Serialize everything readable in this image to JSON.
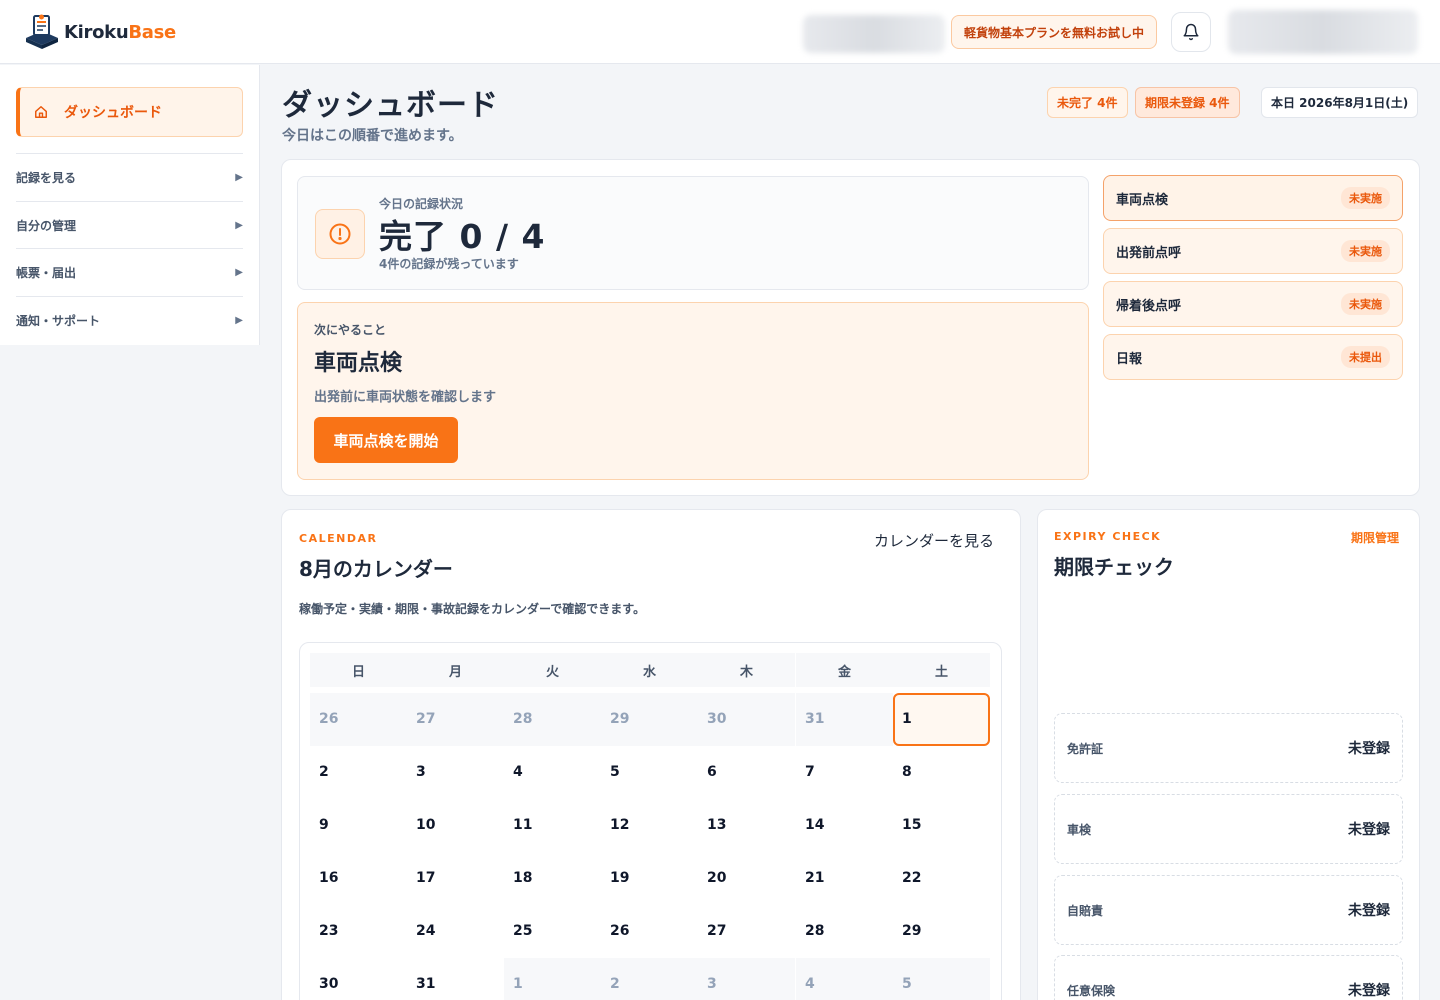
{
  "app": {
    "name_main": "Kiroku",
    "name_accent": "Base"
  },
  "header": {
    "trial_badge": "軽貨物基本プランを無料お試し中"
  },
  "sidebar": {
    "active": "ダッシュボード",
    "items": [
      {
        "label": "記録を見る"
      },
      {
        "label": "自分の管理"
      },
      {
        "label": "帳票・届出"
      },
      {
        "label": "通知・サポート"
      }
    ],
    "arrow": "▶"
  },
  "page": {
    "title": "ダッシュボード",
    "subtitle": "今日はこの順番で進めます。",
    "chips": {
      "incomplete": "未完了 4件",
      "unregistered": "期限未登録 4件",
      "today": "本日 2026年8月1日(土)"
    }
  },
  "status": {
    "label": "今日の記録状況",
    "value": "完了 0 / 4",
    "note": "4件の記録が残っています"
  },
  "next": {
    "label": "次にやること",
    "title": "車両点検",
    "desc": "出発前に車両状態を確認します",
    "button": "車両点検を開始"
  },
  "tasks": [
    {
      "name": "車両点検",
      "status": "未実施"
    },
    {
      "name": "出発前点呼",
      "status": "未実施"
    },
    {
      "name": "帰着後点呼",
      "status": "未実施"
    },
    {
      "name": "日報",
      "status": "未提出"
    }
  ],
  "calendar": {
    "eyebrow": "CALENDAR",
    "title": "8月のカレンダー",
    "link": "カレンダーを見る",
    "desc": "稼働予定・実績・期限・事故記録をカレンダーで確認できます。",
    "weekdays": [
      "日",
      "月",
      "火",
      "水",
      "木",
      "金",
      "土"
    ],
    "weeks": [
      [
        "26",
        "27",
        "28",
        "29",
        "30",
        "31",
        "1"
      ],
      [
        "2",
        "3",
        "4",
        "5",
        "6",
        "7",
        "8"
      ],
      [
        "9",
        "10",
        "11",
        "12",
        "13",
        "14",
        "15"
      ],
      [
        "16",
        "17",
        "18",
        "19",
        "20",
        "21",
        "22"
      ],
      [
        "23",
        "24",
        "25",
        "26",
        "27",
        "28",
        "29"
      ],
      [
        "30",
        "31",
        "1",
        "2",
        "3",
        "4",
        "5"
      ]
    ]
  },
  "expiry": {
    "eyebrow": "EXPIRY CHECK",
    "title": "期限チェック",
    "link": "期限管理",
    "items": [
      {
        "name": "免許証",
        "value": "未登録"
      },
      {
        "name": "車検",
        "value": "未登録"
      },
      {
        "name": "自賠責",
        "value": "未登録"
      },
      {
        "name": "任意保険",
        "value": "未登録"
      }
    ]
  },
  "colors": {
    "accent": "#f97316",
    "text": "#1e293b",
    "muted": "#64748b"
  }
}
